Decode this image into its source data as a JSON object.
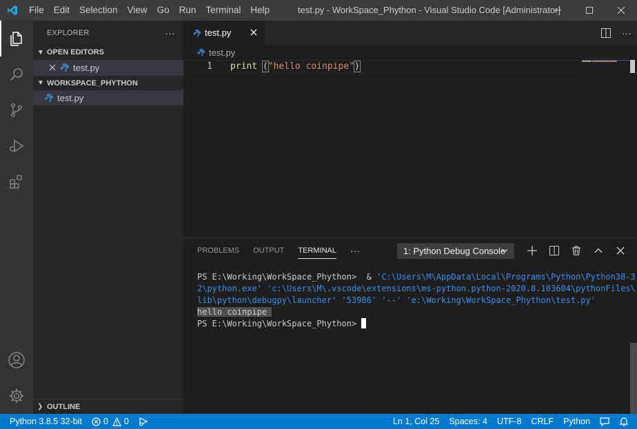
{
  "titlebar": {
    "menu": [
      "File",
      "Edit",
      "Selection",
      "View",
      "Go",
      "Run",
      "Terminal",
      "Help"
    ],
    "window_title": "test.py - WorkSpace_Phython - Visual Studio Code [Administrator]"
  },
  "sidebar": {
    "title": "EXPLORER",
    "more": "···",
    "open_editors_label": "OPEN EDITORS",
    "open_editor_file": "test.py",
    "workspace_label": "WORKSPACE_PHYTHON",
    "workspace_file": "test.py",
    "outline_label": "OUTLINE"
  },
  "editor": {
    "tab_label": "test.py",
    "breadcrumb": "test.py",
    "line_number": "1",
    "code_fn": "print",
    "code_open": "(",
    "code_str": "\"hello coinpipe\"",
    "code_close": ")"
  },
  "panel": {
    "tabs": [
      "PROBLEMS",
      "OUTPUT",
      "TERMINAL"
    ],
    "more": "···",
    "terminal_select": "1: Python Debug Console",
    "terminal_lines": {
      "prompt1": "PS E:\\Working\\WorkSpace_Phython>  & ",
      "cmd1": "'C:\\Users\\M\\AppData\\Local\\Programs\\Python\\Python38-3",
      "cmd2": "2\\python.exe' 'c:\\Users\\M\\.vscode\\extensions\\ms-python.python-2020.8.103604\\pythonFiles\\",
      "cmd3": "lib\\python\\debugpy\\launcher' '53986' '--' 'e:\\Working\\WorkSpace_Phython\\test.py'",
      "output": "hello coinpipe ",
      "prompt2": "PS E:\\Working\\WorkSpace_Phython> "
    }
  },
  "statusbar": {
    "python": "Python 3.8.5 32-bit",
    "errors": "0",
    "warnings": "0",
    "position": "Ln 1, Col 25",
    "spaces": "Spaces: 4",
    "encoding": "UTF-8",
    "eol": "CRLF",
    "language": "Python"
  },
  "colors": {
    "accent": "#007acc",
    "activity_bar": "#333333",
    "sidebar": "#252526",
    "editor": "#1e1e1e",
    "titlebar": "#3c3c3c"
  }
}
